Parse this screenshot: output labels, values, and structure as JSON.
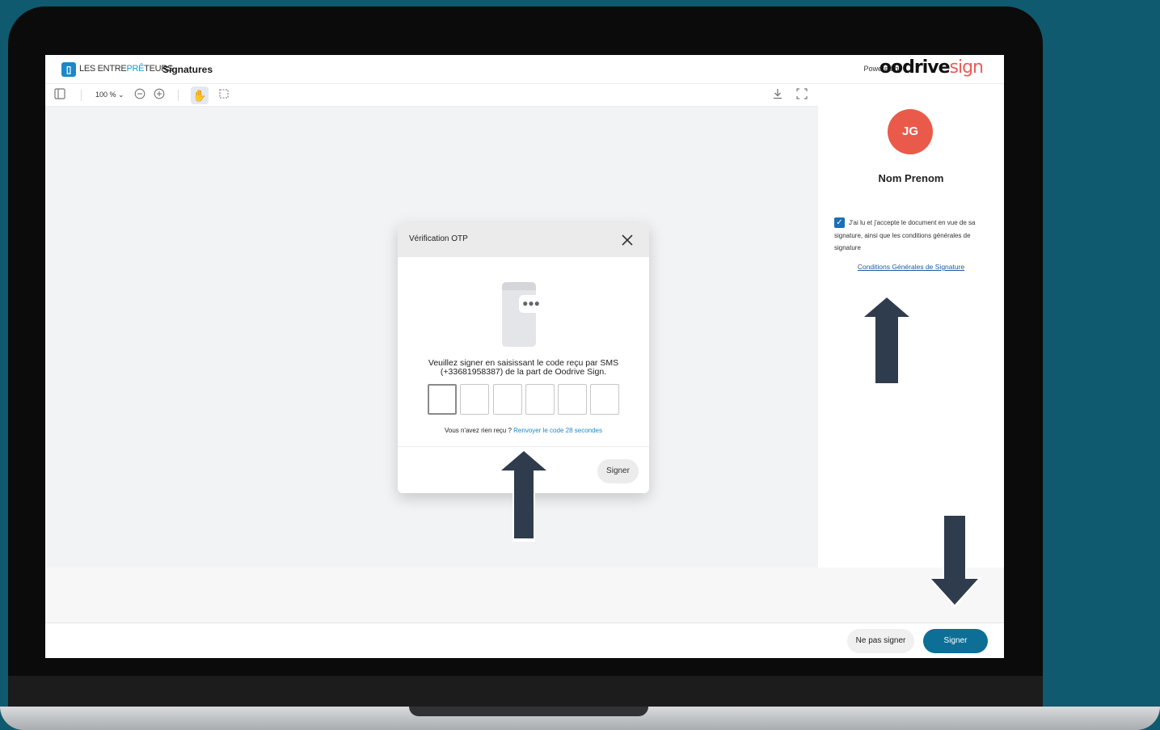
{
  "header": {
    "brand_prefix": "LES ENTRE",
    "brand_accent": "PRÊ",
    "brand_suffix": "TEURS",
    "title": "Signatures",
    "powered_by": "Powered by",
    "provider_word": "oodrive",
    "provider_sign": "sign"
  },
  "toolbar": {
    "zoom": "100 % ⌄"
  },
  "signer": {
    "initials": "JG",
    "name": "Nom Prenom",
    "consent_checked": true,
    "consent_text": "J'ai lu et j'accepte le document en vue de sa signature, ainsi que les conditions générales de signature",
    "cgs_link": "Conditions Générales de Signature"
  },
  "modal": {
    "title": "Vérification OTP",
    "instruction": "Veuillez signer en saisissant le code reçu par SMS (+33681958387) de la part de Oodrive Sign.",
    "otp_length": 6,
    "resend_prefix": "Vous n'avez rien reçu ?",
    "resend_link": "Renvoyer le code 28 secondes",
    "sign_button": "Signer"
  },
  "actions": {
    "decline": "Ne pas signer",
    "sign": "Signer"
  },
  "colors": {
    "background": "#0f5a6e",
    "brand_blue": "#1e87c8",
    "avatar": "#ea5a4a",
    "primary_button": "#0d6e96",
    "arrow": "#2f3c4d"
  }
}
